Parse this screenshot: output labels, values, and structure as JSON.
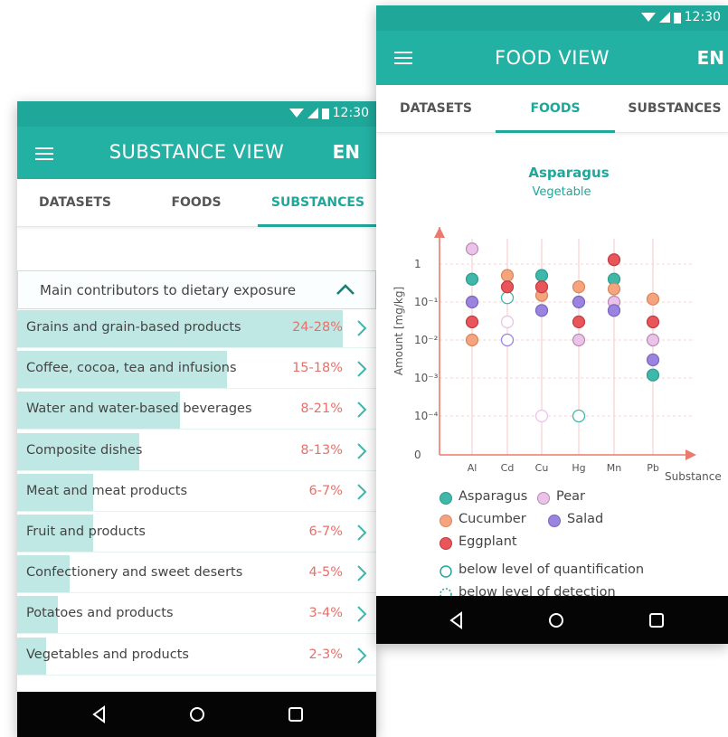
{
  "colors": {
    "teal_dark": "#1fa79a",
    "teal": "#23b1a3",
    "accent_red": "#e8706a",
    "bar_fill": "#bfe8e4",
    "asparagus": "#3fb8a9",
    "cucumber": "#f6a47d",
    "eggplant": "#e8555a",
    "pear": "#ebc3e8",
    "salad": "#9a84e0"
  },
  "substance_view": {
    "status": {
      "time": "12:30"
    },
    "title": "SUBSTANCE VIEW",
    "lang": "EN",
    "tabs": [
      {
        "label": "DATASETS",
        "active": false
      },
      {
        "label": "FOODS",
        "active": false
      },
      {
        "label": "SUBSTANCES",
        "active": true
      }
    ],
    "section_title": "Main contributors to dietary exposure",
    "rows": [
      {
        "label": "Grains and grain-based products",
        "pct": "24-28%",
        "share": 0.28
      },
      {
        "label": "Coffee, cocoa, tea and infusions",
        "pct": "15-18%",
        "share": 0.18
      },
      {
        "label": "Water and water-based beverages",
        "pct": "8-21%",
        "share": 0.14
      },
      {
        "label": "Composite dishes",
        "pct": "8-13%",
        "share": 0.105
      },
      {
        "label": "Meat and meat products",
        "pct": "6-7%",
        "share": 0.065
      },
      {
        "label": "Fruit and products",
        "pct": "6-7%",
        "share": 0.065
      },
      {
        "label": "Confectionery and sweet deserts",
        "pct": "4-5%",
        "share": 0.045
      },
      {
        "label": "Potatoes and products",
        "pct": "3-4%",
        "share": 0.035
      },
      {
        "label": "Vegetables and products",
        "pct": "2-3%",
        "share": 0.025
      }
    ]
  },
  "food_view": {
    "status": {
      "time": "12:30"
    },
    "title": "FOOD VIEW",
    "lang": "EN",
    "tabs": [
      {
        "label": "DATASETS",
        "active": false
      },
      {
        "label": "FOODS",
        "active": true
      },
      {
        "label": "SUBSTANCES",
        "active": false
      }
    ],
    "legend": {
      "asparagus": "Asparagus",
      "pear": "Pear",
      "cucumber": "Cucumber",
      "salad": "Salad",
      "eggplant": "Eggplant",
      "loq": "below level of quantification",
      "lod": "below level of detection"
    }
  },
  "chart_data": {
    "type": "scatter",
    "title": "Asparagus",
    "subtitle": "Vegetable",
    "ylabel": "Amount [mg/kg]",
    "xlabel": "Substance",
    "categories": [
      "Al",
      "Cd",
      "Cu",
      "Hg",
      "Mn",
      "Pb"
    ],
    "y_ticks": [
      "0",
      "10⁻⁴",
      "10⁻³",
      "10⁻²",
      "10⁻¹",
      "1"
    ],
    "y_scale": "log",
    "series": [
      {
        "name": "Asparagus",
        "color": "#3fb8a9",
        "points": [
          {
            "x": "Al",
            "y": 0.4
          },
          {
            "x": "Cd",
            "y": 0.13,
            "open": true
          },
          {
            "x": "Cu",
            "y": 0.5
          },
          {
            "x": "Hg",
            "y": 0.0001,
            "open": true
          },
          {
            "x": "Mn",
            "y": 0.4
          },
          {
            "x": "Pb",
            "y": 0.0012
          }
        ]
      },
      {
        "name": "Pear",
        "color": "#ebc3e8",
        "points": [
          {
            "x": "Al",
            "y": 2.5
          },
          {
            "x": "Cd",
            "y": 0.03,
            "open": true
          },
          {
            "x": "Cu",
            "y": 0.0001,
            "open": true
          },
          {
            "x": "Hg",
            "y": 0.01
          },
          {
            "x": "Mn",
            "y": 0.1
          },
          {
            "x": "Pb",
            "y": 0.01
          }
        ]
      },
      {
        "name": "Cucumber",
        "color": "#f6a47d",
        "points": [
          {
            "x": "Al",
            "y": 0.01
          },
          {
            "x": "Cd",
            "y": 0.5
          },
          {
            "x": "Cu",
            "y": 0.15
          },
          {
            "x": "Hg",
            "y": 0.25
          },
          {
            "x": "Mn",
            "y": 0.22
          },
          {
            "x": "Pb",
            "y": 0.12
          }
        ]
      },
      {
        "name": "Salad",
        "color": "#9a84e0",
        "points": [
          {
            "x": "Al",
            "y": 0.1
          },
          {
            "x": "Cd",
            "y": 0.01,
            "open": true
          },
          {
            "x": "Cu",
            "y": 0.06
          },
          {
            "x": "Hg",
            "y": 0.1
          },
          {
            "x": "Mn",
            "y": 0.06
          },
          {
            "x": "Pb",
            "y": 0.003
          }
        ]
      },
      {
        "name": "Eggplant",
        "color": "#e8555a",
        "points": [
          {
            "x": "Al",
            "y": 0.03
          },
          {
            "x": "Cd",
            "y": 0.25
          },
          {
            "x": "Cu",
            "y": 0.25
          },
          {
            "x": "Hg",
            "y": 0.03
          },
          {
            "x": "Mn",
            "y": 1.3
          },
          {
            "x": "Pb",
            "y": 0.03
          }
        ]
      }
    ]
  }
}
